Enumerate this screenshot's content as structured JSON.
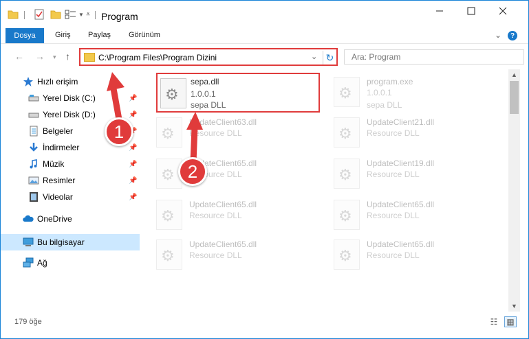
{
  "window": {
    "title": "Program"
  },
  "ribbon": {
    "tabs": [
      "Dosya",
      "Giriş",
      "Paylaş",
      "Görünüm"
    ]
  },
  "address": {
    "path": "C:\\Program Files\\Program Dizini"
  },
  "search": {
    "placeholder": "Ara: Program"
  },
  "sidebar": {
    "items": [
      {
        "label": "Hızlı erişim",
        "icon": "star-icon"
      },
      {
        "label": "Yerel Disk (C:)",
        "icon": "drive-icon",
        "pinned": true
      },
      {
        "label": "Yerel Disk (D:)",
        "icon": "drive-icon",
        "pinned": true
      },
      {
        "label": "Belgeler",
        "icon": "documents-icon",
        "pinned": true
      },
      {
        "label": "İndirmeler",
        "icon": "download-icon",
        "pinned": true
      },
      {
        "label": "Müzik",
        "icon": "music-icon",
        "pinned": true
      },
      {
        "label": "Resimler",
        "icon": "pictures-icon",
        "pinned": true
      },
      {
        "label": "Videolar",
        "icon": "video-icon",
        "pinned": true
      },
      {
        "label": "OneDrive",
        "icon": "cloud-icon"
      },
      {
        "label": "Bu bilgisayar",
        "icon": "computer-icon"
      },
      {
        "label": "Ağ",
        "icon": "network-icon"
      }
    ]
  },
  "files": [
    {
      "name": "sepa.dll",
      "version": "1.0.0.1",
      "desc": "sepa DLL"
    },
    {
      "name": "program.exe",
      "version": "1.0.0.1",
      "desc": "sepa DLL"
    },
    {
      "name": "UpdateClient63.dll",
      "desc": "Resource DLL"
    },
    {
      "name": "UpdateClient21.dll",
      "desc": "Resource DLL"
    },
    {
      "name": "UpdateClient65.dll",
      "desc": "Resource DLL"
    },
    {
      "name": "UpdateClient19.dll",
      "desc": "Resource DLL"
    },
    {
      "name": "UpdateClient65.dll",
      "desc": "Resource DLL"
    },
    {
      "name": "UpdateClient65.dll",
      "desc": "Resource DLL"
    },
    {
      "name": "UpdateClient65.dll",
      "desc": "Resource DLL"
    },
    {
      "name": "UpdateClient65.dll",
      "desc": "Resource DLL"
    }
  ],
  "status": {
    "count": "179 öğe"
  },
  "callouts": [
    "1",
    "2"
  ],
  "colors": {
    "accent": "#1979ca",
    "highlight": "#e03b3b",
    "selected": "#cce8ff"
  }
}
